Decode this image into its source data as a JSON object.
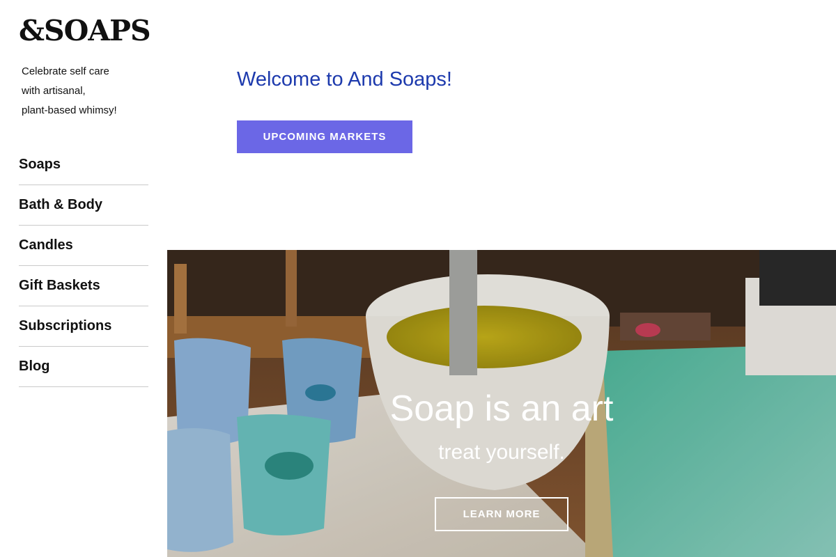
{
  "brand": {
    "logo": "&SOAPS"
  },
  "tagline": [
    "Celebrate self care",
    "with artisanal,",
    "plant-based whimsy!"
  ],
  "nav": {
    "items": [
      {
        "label": "Soaps"
      },
      {
        "label": "Bath & Body"
      },
      {
        "label": "Candles"
      },
      {
        "label": "Gift Baskets"
      },
      {
        "label": "Subscriptions"
      },
      {
        "label": "Blog"
      }
    ]
  },
  "main": {
    "welcome": "Welcome to And Soaps!",
    "markets_button": "UPCOMING MARKETS"
  },
  "hero": {
    "title": "Soap is an art",
    "subtitle": "treat yourself.",
    "button": "LEARN MORE"
  },
  "colors": {
    "accent": "#6b67e6",
    "heading": "#1d3aad"
  }
}
